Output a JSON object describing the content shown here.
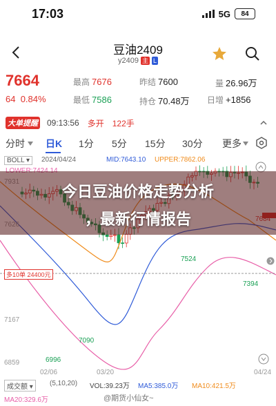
{
  "status": {
    "time": "17:03",
    "signal": "5G",
    "battery": "84"
  },
  "header": {
    "title": "豆油2409",
    "contract": "y2409",
    "tag_main": "主",
    "tag_l": "L",
    "back_icon": "chevron-left-icon",
    "star_icon": "star-icon",
    "search_icon": "search-icon"
  },
  "quote": {
    "price": "7664",
    "change": "64",
    "change_pct": "0.84%",
    "high_label": "最高",
    "high": "7676",
    "low_label": "最低",
    "low": "7586",
    "prev_label": "昨结",
    "prev": "7600",
    "oi_label": "持仓",
    "oi": "70.48万",
    "vol_label": "量",
    "vol": "26.96万",
    "daily_label": "日增",
    "daily": "+1856"
  },
  "alert": {
    "logo": "大单提醒",
    "time": "09:13:56",
    "action": "多开",
    "qty": "122手"
  },
  "tabs": [
    "分时",
    "日K",
    "1分",
    "5分",
    "15分",
    "30分",
    "更多"
  ],
  "indicators": {
    "boll": "BOLL",
    "date": "2024/04/24",
    "mid": "MID:7643.10",
    "upper": "UPPER:7862.06",
    "lower": "LOWER:7424.14"
  },
  "chart_labels": {
    "y_top": "7931",
    "y_mid": "7626",
    "y_low": "7167",
    "y_bottom": "6859",
    "peak": "7684",
    "mark_7524": "7524",
    "mark_7394": "7394",
    "mark_7090": "7090",
    "mark_6996": "6996",
    "line_label": "多10单 24400元",
    "x_start": "02/06",
    "x_mid": "03/20",
    "x_end": "04/24"
  },
  "headline": {
    "line1": "今日豆油价格走势分析",
    "line2": "，最新行情报告"
  },
  "bottom": {
    "vol_label": "成交额",
    "params": "(5,10,20)",
    "vol": "VOL:39.23万",
    "ma5": "MA5:385.0万",
    "ma10": "MA10:421.5万",
    "ma20": "MA20:329.6万"
  },
  "watermark": "@期货小仙女~",
  "colors": {
    "up": "#e0322c",
    "down": "#1aa055",
    "accent": "#2f5bd8",
    "mid": "#2f5bd8",
    "upper": "#f08c1c",
    "lower": "#e85fa8"
  }
}
